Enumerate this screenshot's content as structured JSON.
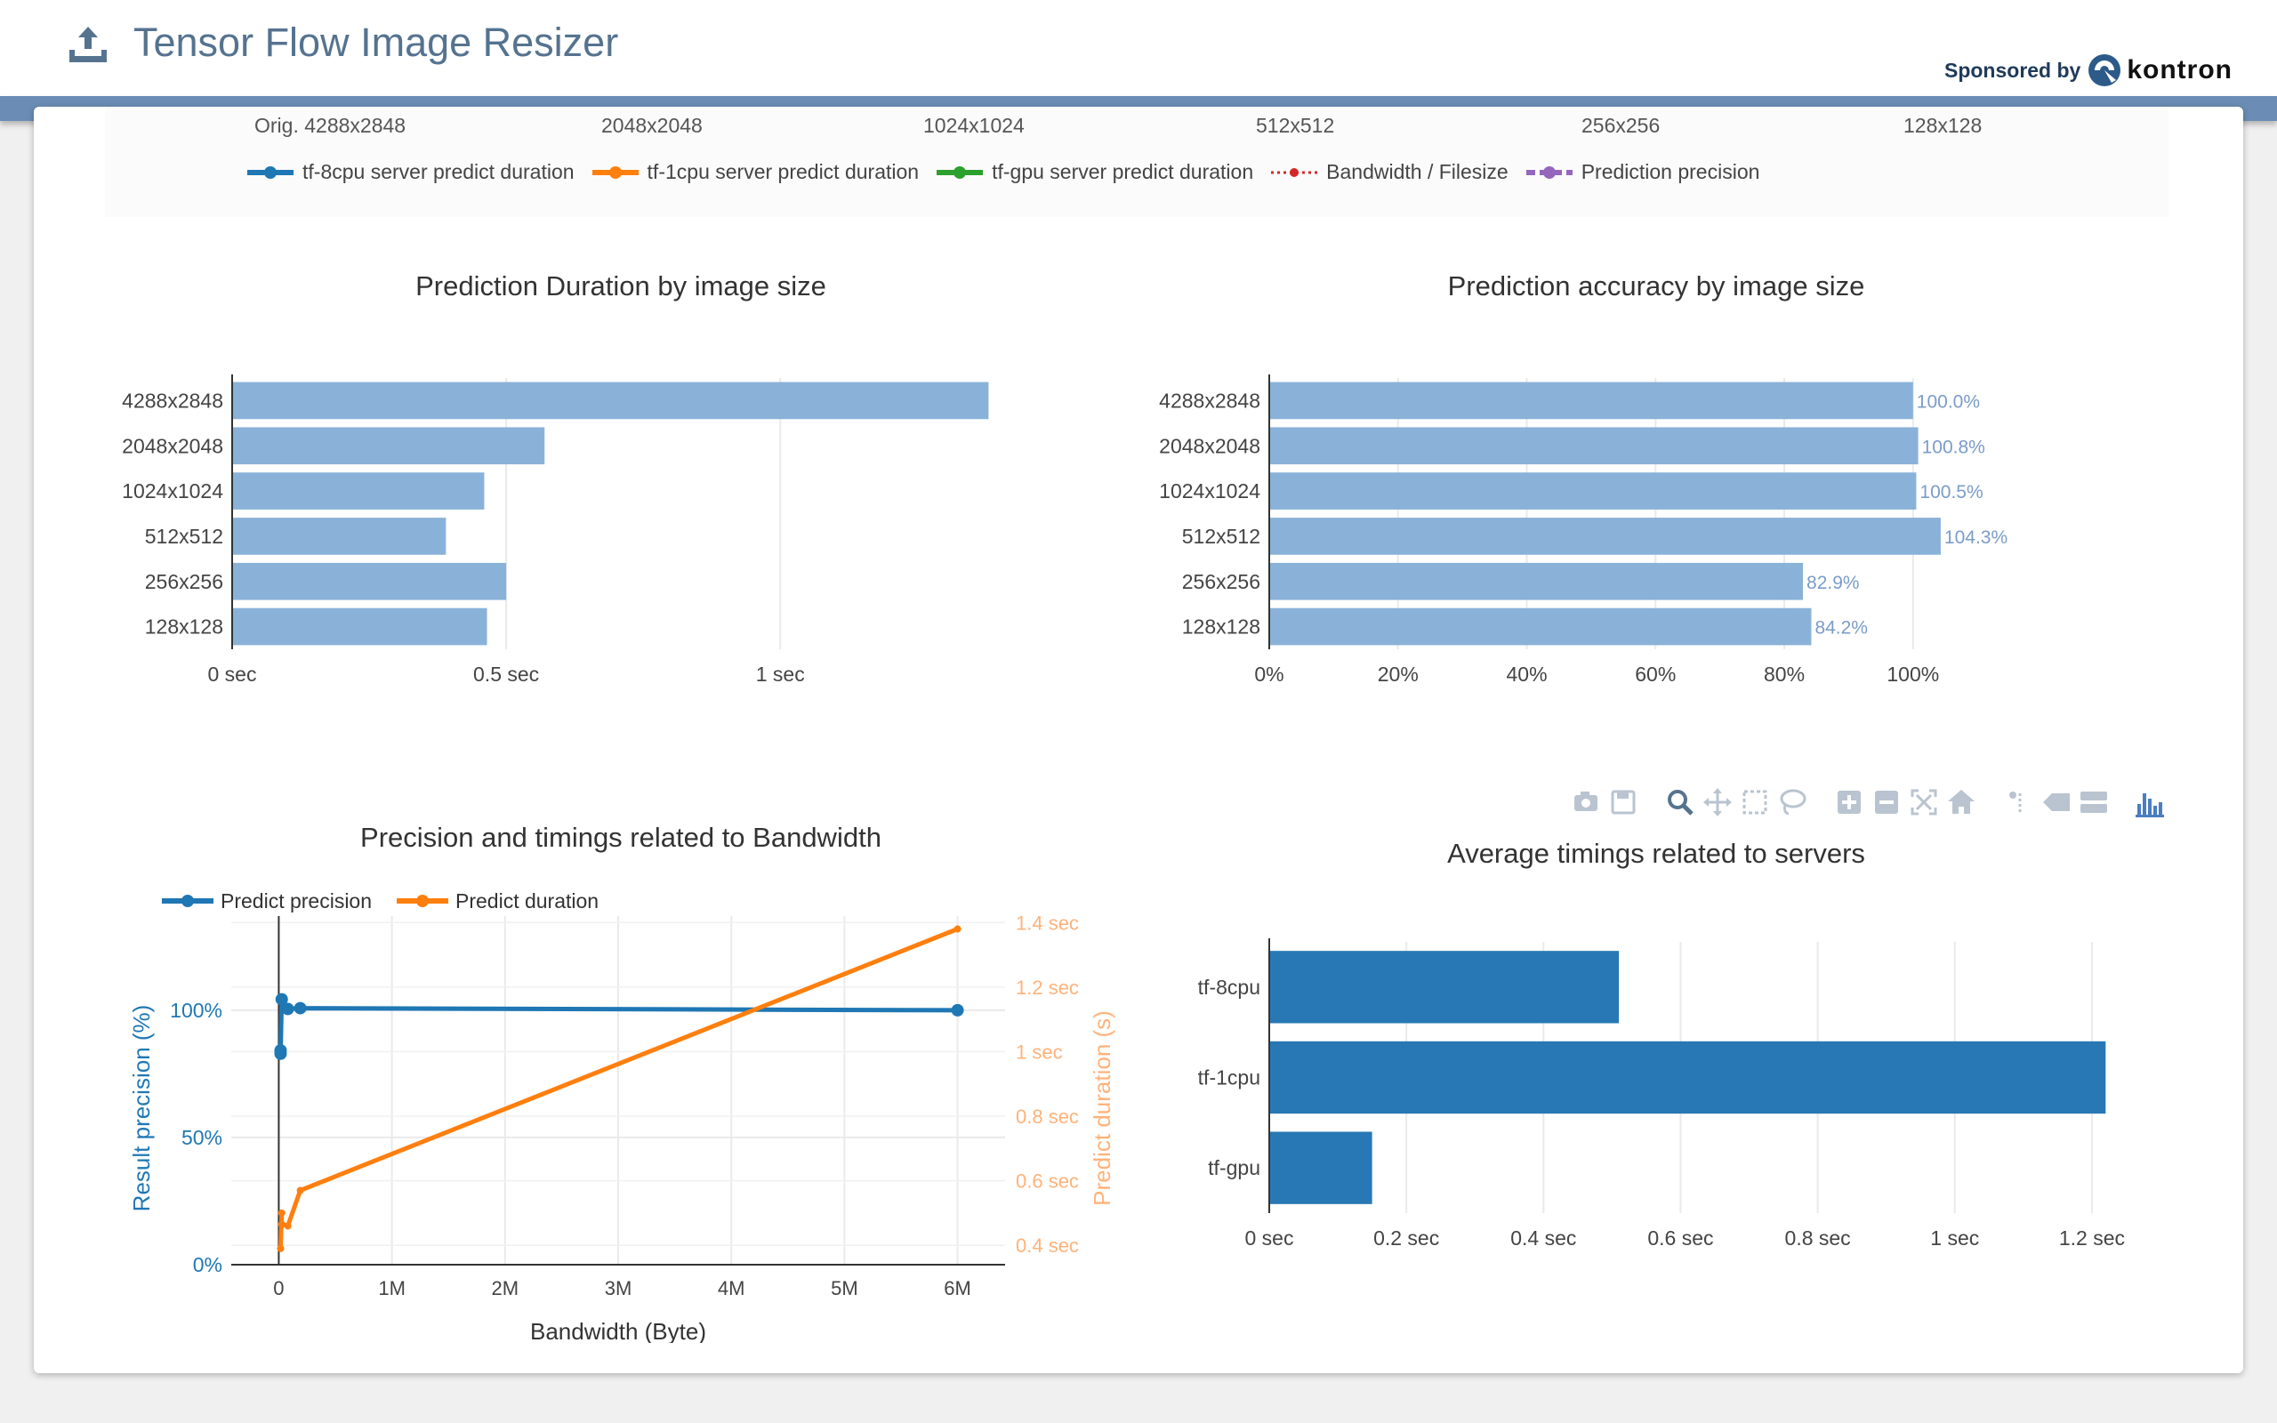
{
  "header": {
    "title": "Tensor Flow Image Resizer",
    "sponsor_label": "Sponsored by",
    "sponsor_name": "kontron"
  },
  "image_sizes": [
    "Orig. 4288x2848",
    "2048x2048",
    "1024x1024",
    "512x512",
    "256x256",
    "128x128"
  ],
  "legend": [
    {
      "label": "tf-8cpu server predict duration",
      "color": "#1f77b4",
      "style": "line-marker"
    },
    {
      "label": "tf-1cpu server predict duration",
      "color": "#ff7f0e",
      "style": "line-marker"
    },
    {
      "label": "tf-gpu server predict duration",
      "color": "#2ca02c",
      "style": "line-marker"
    },
    {
      "label": "Bandwidth / Filesize",
      "color": "#d62728",
      "style": "dotted-marker"
    },
    {
      "label": "Prediction precision",
      "color": "#9467bd",
      "style": "dashed-marker"
    }
  ],
  "modebar": [
    "camera-icon",
    "save-icon",
    "zoom-icon",
    "pan-icon",
    "box-select-icon",
    "lasso-select-icon",
    "zoom-in-icon",
    "zoom-out-icon",
    "autoscale-icon",
    "reset-axes-icon",
    "spike-lines-icon",
    "hover-closest-icon",
    "hover-compare-icon",
    "plotly-logo-icon"
  ],
  "chart_data": [
    {
      "type": "bar",
      "orientation": "horizontal",
      "title": "Prediction Duration by image size",
      "categories": [
        "4288x2848",
        "2048x2048",
        "1024x1024",
        "512x512",
        "256x256",
        "128x128"
      ],
      "values": [
        1.38,
        0.57,
        0.46,
        0.39,
        0.5,
        0.465
      ],
      "xticks": [
        "0 sec",
        "0.5 sec",
        "1 sec"
      ],
      "xtick_values": [
        0,
        0.5,
        1
      ],
      "xlim": [
        0,
        1.48
      ],
      "color": "#8ab2d8"
    },
    {
      "type": "bar",
      "orientation": "horizontal",
      "title": "Prediction accuracy by image size",
      "categories": [
        "4288x2848",
        "2048x2048",
        "1024x1024",
        "512x512",
        "256x256",
        "128x128"
      ],
      "values": [
        100.0,
        100.8,
        100.5,
        104.3,
        82.9,
        84.2
      ],
      "data_labels": [
        "100.0%",
        "100.8%",
        "100.5%",
        "104.3%",
        "82.9%",
        "84.2%"
      ],
      "xticks": [
        "0%",
        "20%",
        "40%",
        "60%",
        "80%",
        "100%"
      ],
      "xtick_values": [
        0,
        20,
        40,
        60,
        80,
        100
      ],
      "xlim": [
        0,
        126
      ],
      "color": "#8ab2d8",
      "label_color": "#7a9cc8"
    },
    {
      "type": "line",
      "title": "Precision and timings related to Bandwidth",
      "xlabel": "Bandwidth (Byte)",
      "ylabel": "Result precision (%)",
      "y2label": "Predict duration (s)",
      "xticks": [
        "0",
        "1M",
        "2M",
        "3M",
        "4M",
        "5M",
        "6M"
      ],
      "xtick_values": [
        0,
        1000000,
        2000000,
        3000000,
        4000000,
        5000000,
        6000000
      ],
      "xlim": [
        -420000,
        6420000
      ],
      "yticks": [
        "0%",
        "50%",
        "100%"
      ],
      "ytick_values": [
        0,
        50,
        100
      ],
      "ylim": [
        0,
        137
      ],
      "y2ticks": [
        "0.4 sec",
        "0.6 sec",
        "0.8 sec",
        "1 sec",
        "1.2 sec",
        "1.4 sec"
      ],
      "y2tick_values": [
        0.4,
        0.6,
        0.8,
        1.0,
        1.2,
        1.4
      ],
      "y2lim": [
        0.34,
        1.42
      ],
      "series": [
        {
          "name": "Predict precision",
          "axis": "y",
          "color": "#1f77b4",
          "markers": true,
          "points": [
            [
              16000,
              82.9
            ],
            [
              16000,
              84.2
            ],
            [
              26000,
              104.3
            ],
            [
              80000,
              100.5
            ],
            [
              190000,
              100.8
            ],
            [
              6000000,
              100.0
            ]
          ]
        },
        {
          "name": "Predict duration",
          "axis": "y2",
          "color": "#ff7f0e",
          "markers": false,
          "points": [
            [
              16000,
              0.39
            ],
            [
              26000,
              0.5
            ],
            [
              26000,
              0.465
            ],
            [
              80000,
              0.46
            ],
            [
              190000,
              0.57
            ],
            [
              6000000,
              1.38
            ]
          ]
        }
      ]
    },
    {
      "type": "bar",
      "orientation": "horizontal",
      "title": "Average timings related to servers",
      "categories": [
        "tf-8cpu",
        "tf-1cpu",
        "tf-gpu"
      ],
      "values": [
        0.51,
        1.22,
        0.15
      ],
      "xticks": [
        "0 sec",
        "0.2 sec",
        "0.4 sec",
        "0.6 sec",
        "0.8 sec",
        "1 sec",
        "1.2 sec"
      ],
      "xtick_values": [
        0,
        0.2,
        0.4,
        0.6,
        0.8,
        1.0,
        1.2
      ],
      "xlim": [
        0,
        1.3
      ],
      "color": "#2878b5"
    }
  ]
}
